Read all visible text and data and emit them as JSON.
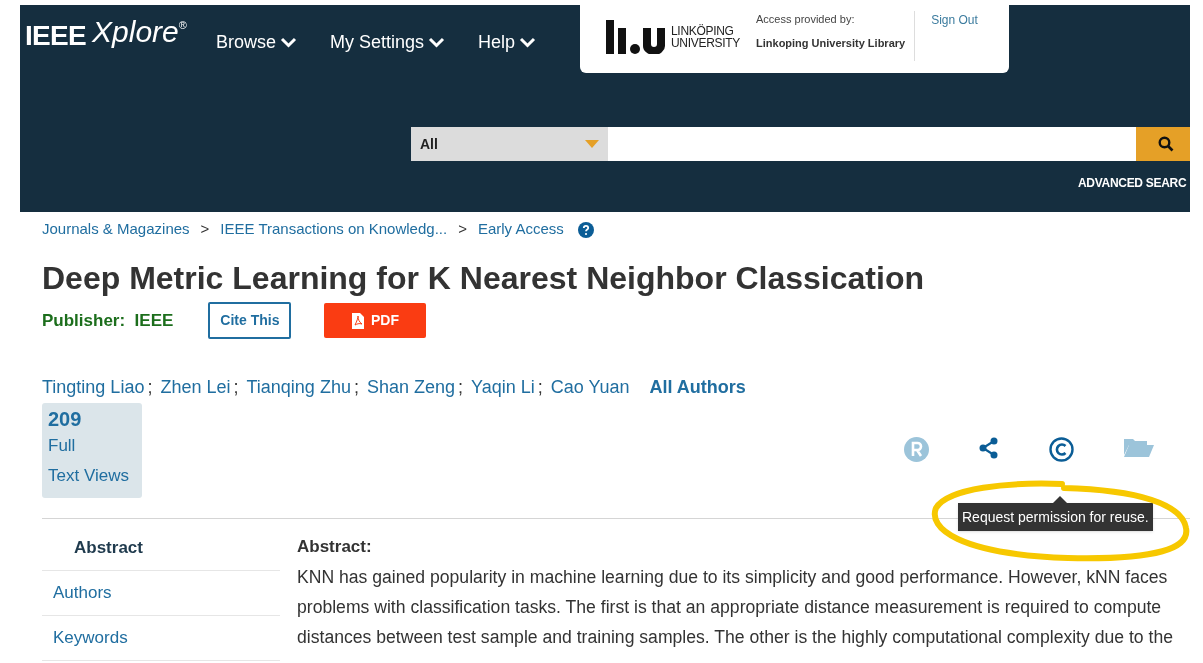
{
  "header": {
    "logo": {
      "brand": "IEEE",
      "product": "Xplore",
      "mark": "®"
    },
    "nav": [
      {
        "label": "Browse"
      },
      {
        "label": "My Settings"
      },
      {
        "label": "Help"
      }
    ],
    "access": {
      "institution_logo": [
        "LINKÖPING",
        "UNIVERSITY"
      ],
      "label": "Access provided by:",
      "institution": "Linkoping University Library",
      "sign_out": "Sign Out"
    },
    "search": {
      "scope": "All",
      "advanced": "ADVANCED SEARC"
    }
  },
  "breadcrumb": [
    {
      "kind": "link",
      "text": "Journals & Magazines"
    },
    {
      "kind": "separator",
      "text": ">"
    },
    {
      "kind": "link",
      "text": "IEEE Transactions on Knowledg..."
    },
    {
      "kind": "separator",
      "text": ">"
    },
    {
      "kind": "link",
      "text": "Early Access"
    }
  ],
  "title": "Deep Metric Learning for K Nearest Neighbor Classication",
  "publisher": {
    "label": "Publisher:",
    "value": "IEEE"
  },
  "buttons": [
    {
      "kind": "outline",
      "label": "Cite This"
    },
    {
      "kind": "pdf",
      "label": "PDF"
    }
  ],
  "authors": [
    {
      "name": "Tingting Liao",
      "separator": ";"
    },
    {
      "name": "Zhen Lei",
      "separator": ";"
    },
    {
      "name": "Tianqing Zhu",
      "separator": ";"
    },
    {
      "name": "Shan Zeng",
      "separator": ";"
    },
    {
      "name": "Yaqin Li",
      "separator": ";"
    },
    {
      "name": "Cao Yuan"
    }
  ],
  "all_authors": "All Authors",
  "metrics": {
    "count": "209",
    "lines": [
      "Full",
      "Text Views"
    ]
  },
  "tooltip": "Request permission for reuse.",
  "sidebar": [
    {
      "label": "Abstract",
      "selected": true
    },
    {
      "label": "Authors",
      "selected": false
    },
    {
      "label": "Keywords",
      "selected": false
    }
  ],
  "abstract": {
    "heading": "Abstract:",
    "lines": [
      "KNN has gained popularity in machine learning due to its simplicity and good performance. However, kNN faces",
      "problems with classification tasks. The first is that an appropriate distance measurement is required to compute",
      "distances between test sample and training samples. The other is the highly computational complexity due to the"
    ]
  }
}
